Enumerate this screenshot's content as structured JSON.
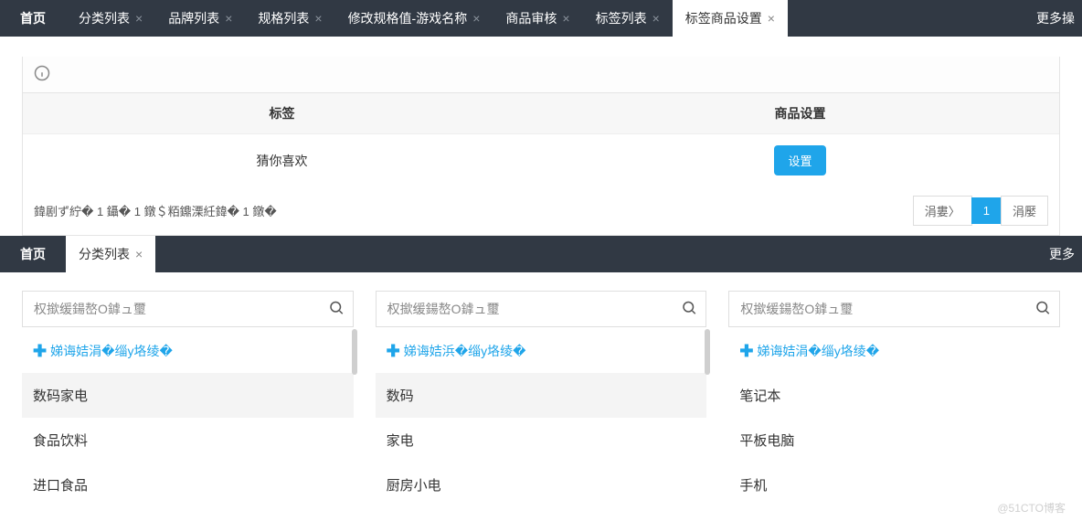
{
  "region1": {
    "home": "首页",
    "tabs": [
      {
        "label": "分类列表",
        "closable": true,
        "active": false
      },
      {
        "label": "品牌列表",
        "closable": true,
        "active": false
      },
      {
        "label": "规格列表",
        "closable": true,
        "active": false
      },
      {
        "label": "修改规格值-游戏名称",
        "closable": true,
        "active": false
      },
      {
        "label": "商品审核",
        "closable": true,
        "active": false
      },
      {
        "label": "标签列表",
        "closable": true,
        "active": false
      },
      {
        "label": "标签商品设置",
        "closable": true,
        "active": true
      }
    ],
    "more": "更多操",
    "table": {
      "headers": [
        "标签",
        "商品设置"
      ],
      "row": {
        "label": "猜你喜欢",
        "button": "设置"
      }
    },
    "pager": {
      "info": "鍏剧ず紵� 1 鑷� 1 鐓＄粨鐤溧紝鍏� 1 鐓�",
      "prev": "涓婁〉",
      "page1": "1",
      "next": "涓嬮"
    }
  },
  "region2": {
    "home": "首页",
    "tabs": [
      {
        "label": "分类列表",
        "closable": true,
        "active": true
      }
    ],
    "more": "更多",
    "columns": [
      {
        "placeholder": "权撳缓鍚嶅O鎼ュ璽",
        "addLabel": "娣诲姞涓�缁у垎绫�",
        "items": [
          {
            "t": "数码家电",
            "sel": true
          },
          {
            "t": "食品饮料",
            "sel": false
          },
          {
            "t": "进口食品",
            "sel": false
          }
        ]
      },
      {
        "placeholder": "权撳缓鍚嶅O鎼ュ璽",
        "addLabel": "娣诲姞浜�缁у垎绫�",
        "items": [
          {
            "t": "数码",
            "sel": true
          },
          {
            "t": "家电",
            "sel": false
          },
          {
            "t": "厨房小电",
            "sel": false
          }
        ]
      },
      {
        "placeholder": "权撳缓鍚嶅O鎼ュ璽",
        "addLabel": "娣诲姞涓�缁у垎绫�",
        "items": [
          {
            "t": "笔记本",
            "sel": false
          },
          {
            "t": "平板电脑",
            "sel": false
          },
          {
            "t": "手机",
            "sel": false
          }
        ]
      }
    ]
  },
  "watermark": "@51CTO博客"
}
